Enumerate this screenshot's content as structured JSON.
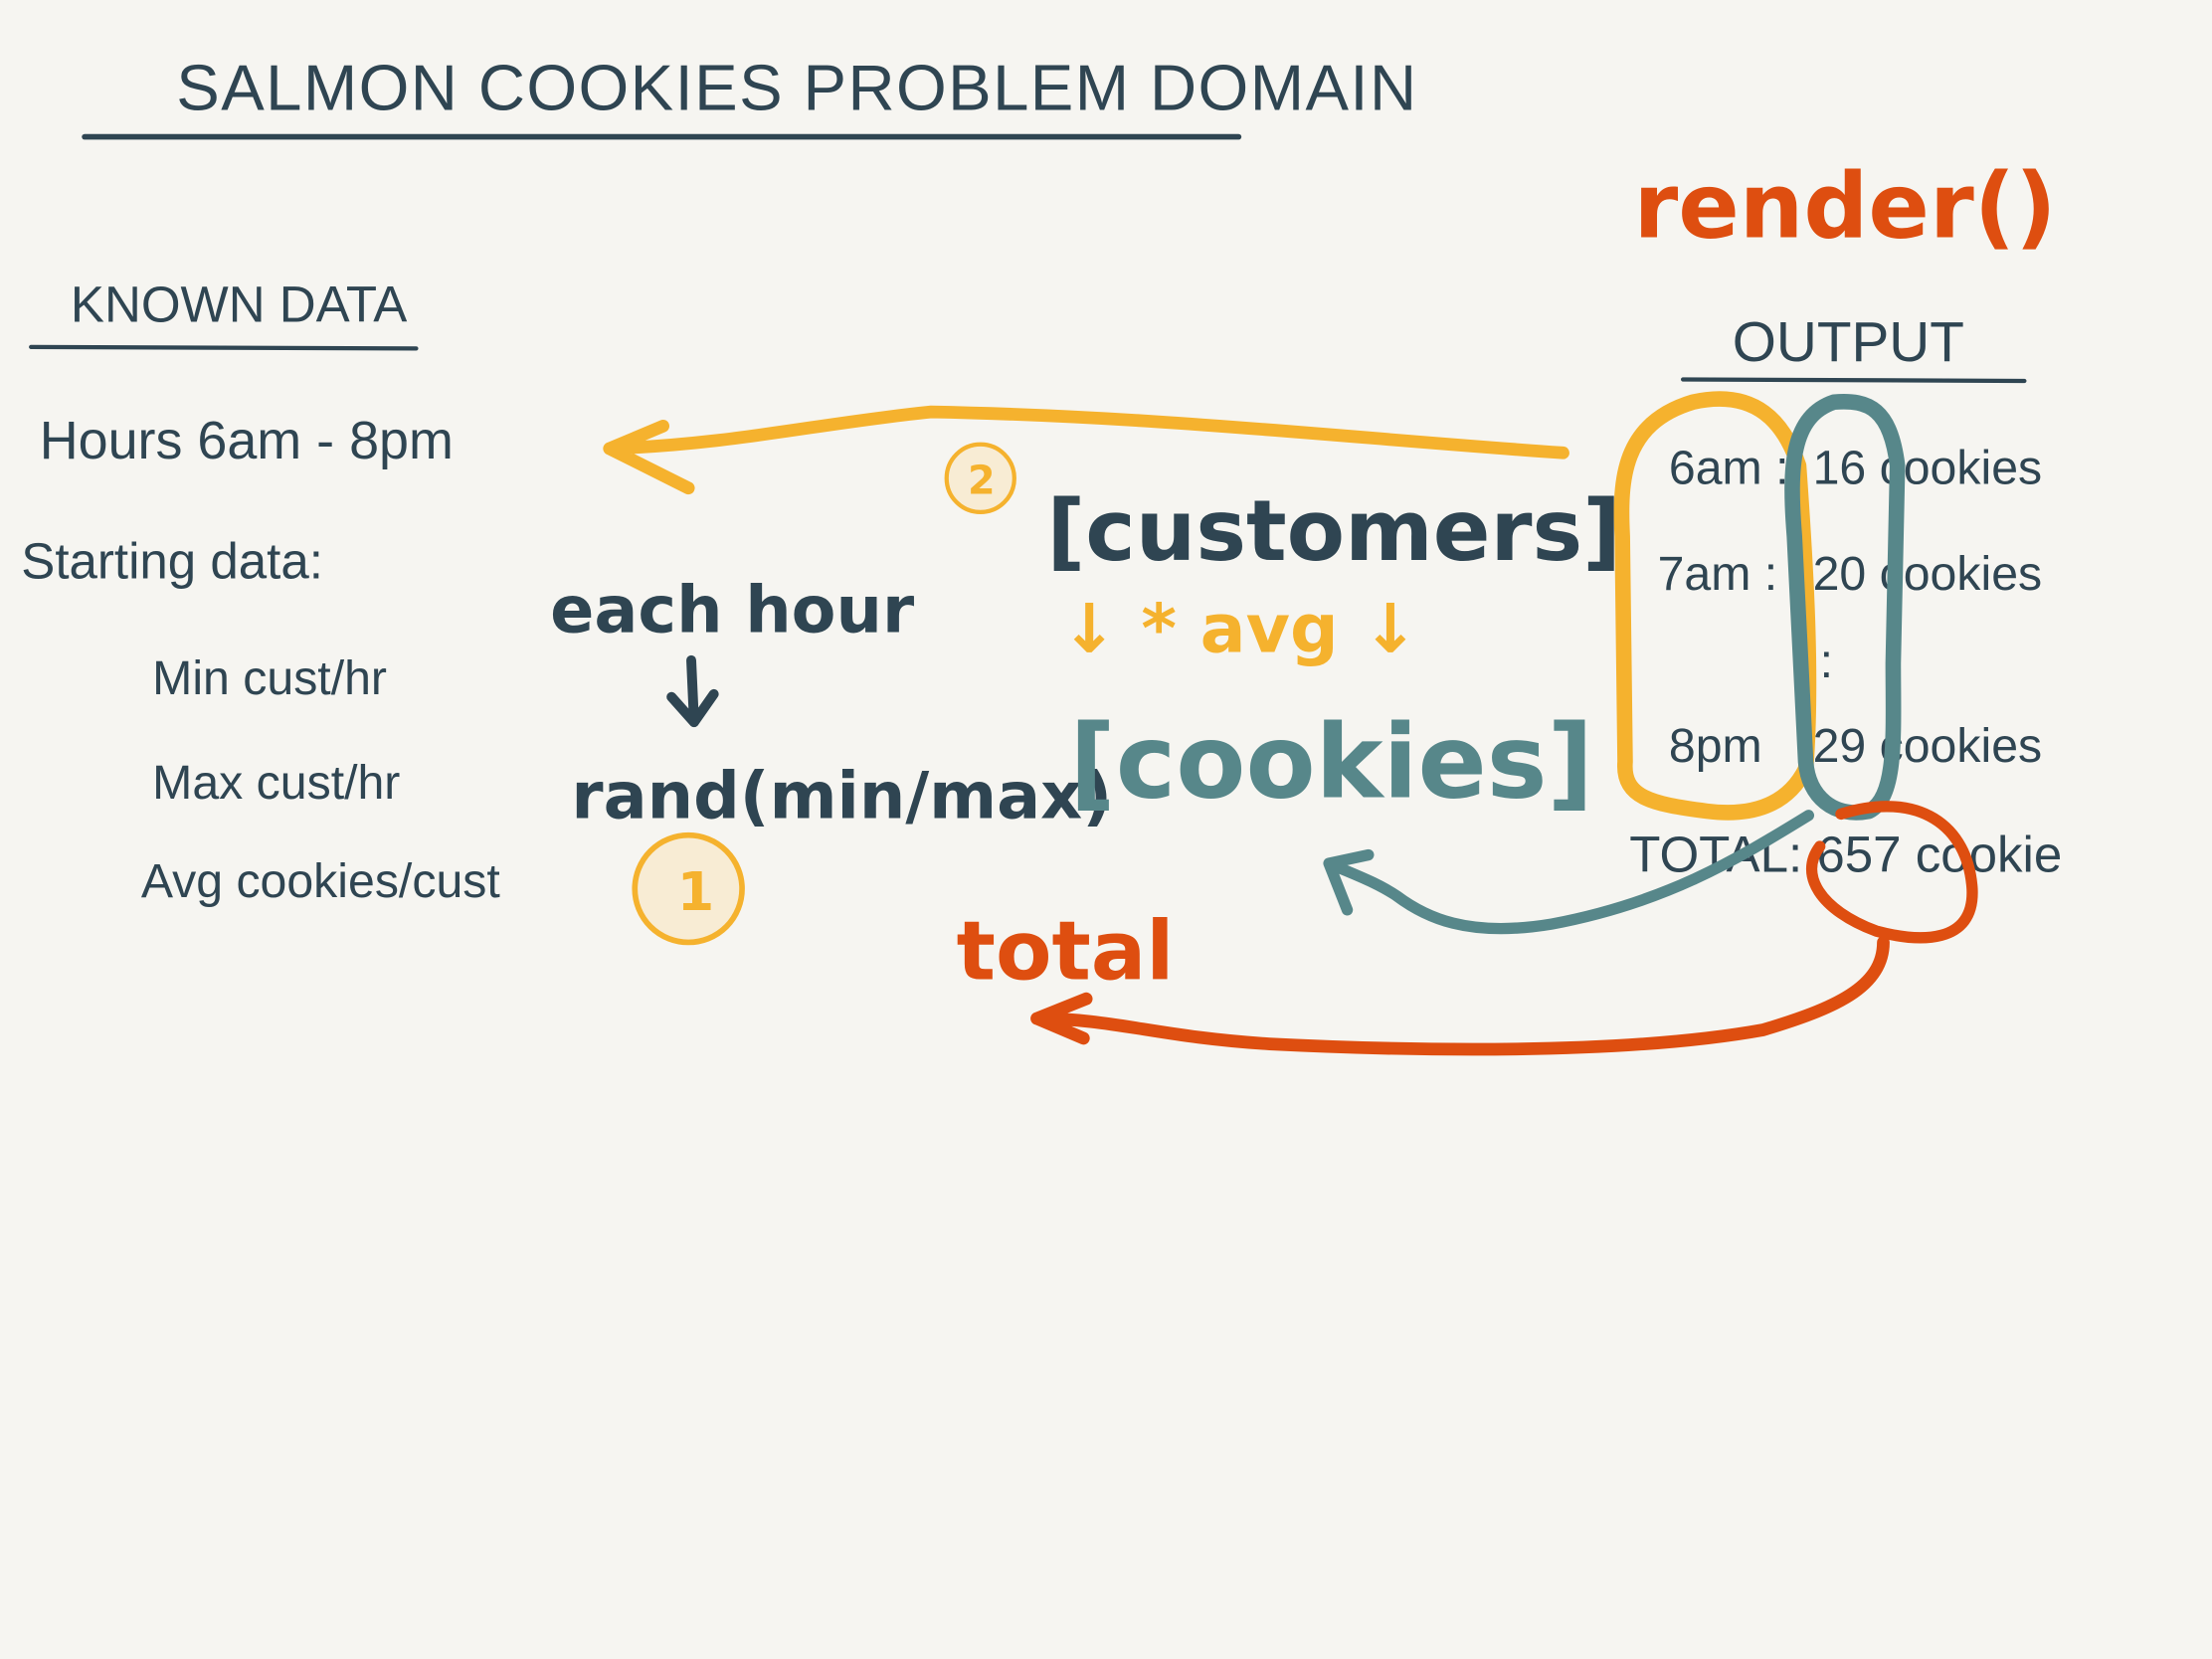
{
  "colors": {
    "background": "#f6f5f1",
    "ink": "#2f4552",
    "teal": "#57878a",
    "yellow": "#f5b22e",
    "orange": "#de4e10"
  },
  "title": "SALMON COOKIES PROBLEM DOMAIN",
  "known_data": {
    "heading": "KNOWN DATA",
    "hours": "Hours  6am - 8pm",
    "starting_label": "Starting data:",
    "items": [
      "Min cust/hr",
      "Max cust/hr",
      "Avg cookies/cust"
    ]
  },
  "flow": {
    "each_hour": "each hour",
    "rand": "rand(min/max)",
    "step1": "1",
    "step2": "2",
    "customers": "[customers]",
    "avg": "↓ * avg ↓",
    "cookies": "[cookies]",
    "total": "total"
  },
  "render": "render()",
  "output": {
    "heading": "OUTPUT",
    "rows": [
      {
        "hour": "6am :",
        "cookies": "16 cookies"
      },
      {
        "hour": "7am :",
        "cookies": "20 cookies"
      },
      {
        "hour": "",
        "cookies": ":"
      },
      {
        "hour": "8pm",
        "cookies": "29 cookies"
      }
    ],
    "total": "TOTAL: 657 cookie"
  }
}
